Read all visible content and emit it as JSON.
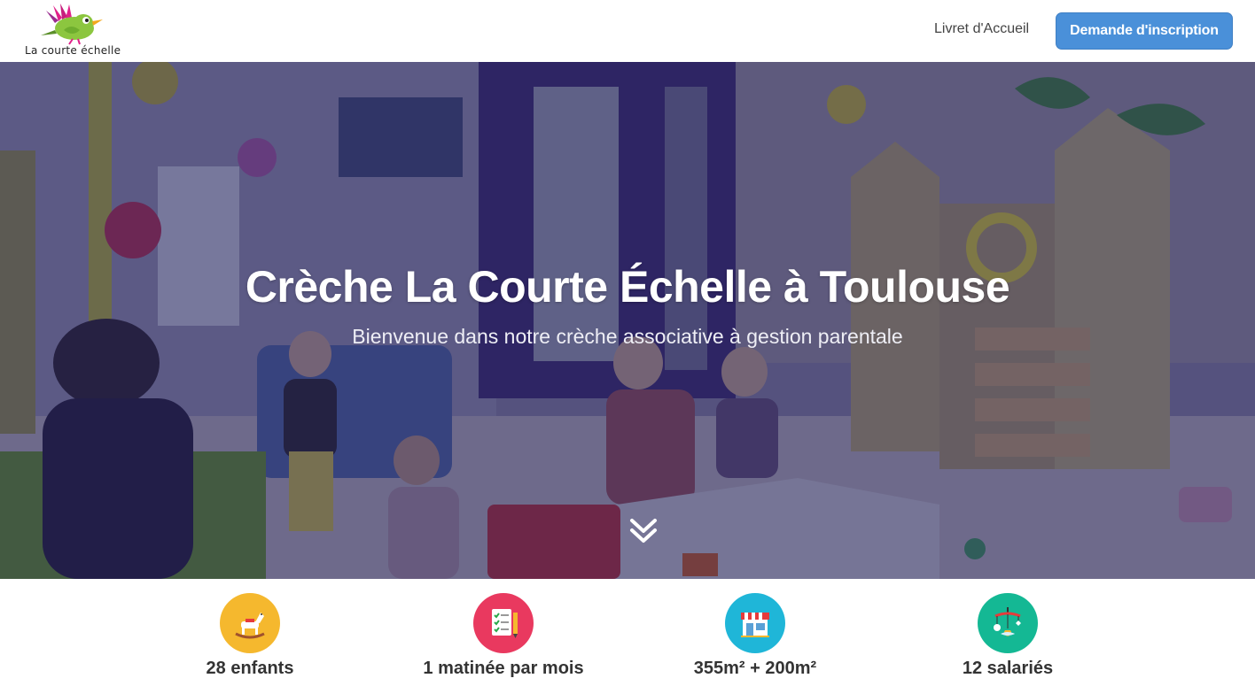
{
  "header": {
    "logo_text": "La courte échelle",
    "nav_link": "Livret d'Accueil",
    "cta_label": "Demande d'inscription"
  },
  "hero": {
    "title": "Crèche La Courte Échelle à Toulouse",
    "subtitle": "Bienvenue dans notre crèche associative à gestion parentale",
    "scroll_icon": "double-chevron-down-icon"
  },
  "features": [
    {
      "icon": "rocking-horse-icon",
      "color": "#f5b82e",
      "label": "28 enfants"
    },
    {
      "icon": "checklist-pencil-icon",
      "color": "#e9395f",
      "label": "1 matinée par mois"
    },
    {
      "icon": "storefront-icon",
      "color": "#1fb6d8",
      "label": "355m² + 200m²"
    },
    {
      "icon": "baby-mobile-icon",
      "color": "#14b894",
      "label": "12 salariés"
    }
  ],
  "colors": {
    "brand_blue": "#4a90d9",
    "hero_overlay": "#1c1846"
  }
}
